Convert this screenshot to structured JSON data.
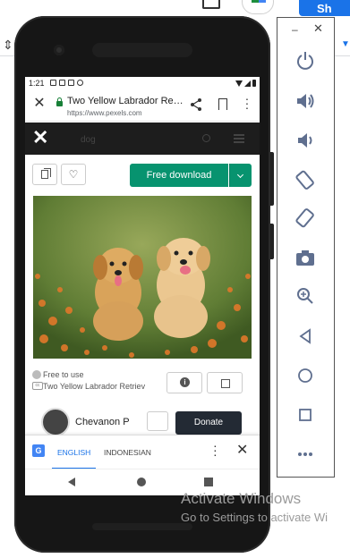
{
  "host": {
    "share_label": "Sh"
  },
  "phone": {
    "status": {
      "time": "1:21"
    },
    "browser": {
      "page_title": "Two Yellow Labrador Retr...",
      "url": "https://www.pexels.com"
    },
    "site": {
      "search_text": "dog"
    },
    "toolbar": {
      "download_label": "Free download"
    },
    "info": {
      "license": "Free to use",
      "title": "Two Yellow Labrador Retriev"
    },
    "author": {
      "name": "Chevanon P",
      "donate_label": "Donate"
    },
    "translate": {
      "logo": "G",
      "lang_active": "ENGLISH",
      "lang_other": "INDONESIAN"
    }
  },
  "emulator": {
    "tools": [
      "power-icon",
      "volume-up-icon",
      "volume-down-icon",
      "rotate-left-icon",
      "rotate-right-icon",
      "camera-icon",
      "zoom-icon",
      "back-icon",
      "home-icon",
      "overview-icon",
      "more-icon"
    ]
  },
  "watermark": {
    "line1": "Activate Windows",
    "line2": "Go to Settings to activate Wi"
  },
  "colors": {
    "download_green": "#07936f",
    "donate_dark": "#232a34",
    "translate_blue": "#1a73e8"
  }
}
